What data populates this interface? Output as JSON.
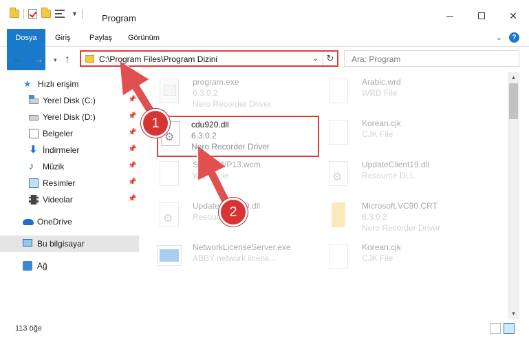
{
  "window": {
    "title": "Program"
  },
  "ribbon": {
    "tabs": [
      {
        "label": "Dosya"
      },
      {
        "label": "Giriş"
      },
      {
        "label": "Paylaş"
      },
      {
        "label": "Görünüm"
      }
    ],
    "help_label": "?"
  },
  "address": {
    "path": "C:\\Program Files\\Program Dizini"
  },
  "search": {
    "placeholder": "Ara: Program"
  },
  "sidebar": {
    "items": [
      {
        "label": "Hızlı erişim",
        "icon": "star-icon"
      },
      {
        "label": "Yerel Disk (C:)",
        "icon": "drive-c-icon",
        "pinned": true
      },
      {
        "label": "Yerel Disk (D:)",
        "icon": "drive-d-icon",
        "pinned": true
      },
      {
        "label": "Belgeler",
        "icon": "documents-icon",
        "pinned": true
      },
      {
        "label": "İndirmeler",
        "icon": "downloads-icon",
        "pinned": true
      },
      {
        "label": "Müzik",
        "icon": "music-icon",
        "pinned": true
      },
      {
        "label": "Resimler",
        "icon": "pictures-icon",
        "pinned": true
      },
      {
        "label": "Videolar",
        "icon": "videos-icon",
        "pinned": true
      },
      {
        "label": "OneDrive",
        "icon": "onedrive-icon"
      },
      {
        "label": "Bu bilgisayar",
        "icon": "this-pc-icon",
        "selected": true
      },
      {
        "label": "Ağ",
        "icon": "network-icon"
      }
    ]
  },
  "files": [
    {
      "name": "program.exe",
      "version": "6.3.0.2",
      "desc": "Nero Recorder Driver",
      "icon": "exe-icon"
    },
    {
      "name": "Arabic.wrd",
      "desc": "WRD File",
      "icon": "file-icon"
    },
    {
      "name": "cdu920.dll",
      "version": "6.3.0.2",
      "desc": "Nero Recorder Driver",
      "icon": "dll-gear-icon"
    },
    {
      "name": "Korean.cjk",
      "desc": "CJK File",
      "icon": "file-icon"
    },
    {
      "name": "SecureWP13.wcm",
      "desc": "WCM File",
      "icon": "file-icon"
    },
    {
      "name": "UpdateClient19.dll",
      "desc": "Resource DLL",
      "icon": "dll-gear-icon"
    },
    {
      "name": "UpdateClient19.dll",
      "desc": "Resource",
      "icon": "dll-gear-icon"
    },
    {
      "name": "Microsoft.VC90.CRT",
      "version": "6.3.0.2",
      "desc": "Nero Recorder Driver",
      "icon": "crt-icon"
    },
    {
      "name": "NetworkLicenseServer.exe",
      "desc": "ABBY network licens...",
      "icon": "nlse-icon"
    },
    {
      "name": "Korean.cjk",
      "desc": "CJK File",
      "icon": "file-icon"
    }
  ],
  "status": {
    "count": "113 öğe"
  },
  "annotations": {
    "step1": "1",
    "step2": "2"
  },
  "colors": {
    "accent": "#1979ca",
    "highlight": "#e03a3a",
    "badge": "#d83434"
  }
}
